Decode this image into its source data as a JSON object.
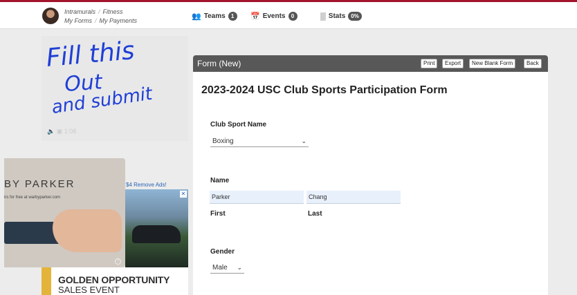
{
  "header": {
    "crumb_intramurals": "Intramurals",
    "crumb_sep": "/",
    "crumb_fitness": "Fitness",
    "my_forms": "My Forms",
    "my_payments": "My Payments",
    "nav": [
      {
        "label": "Teams",
        "count": "1",
        "icon": "people-icon"
      },
      {
        "label": "Events",
        "count": "0",
        "icon": "calendar-icon"
      },
      {
        "label": "Stats",
        "count": "0%",
        "icon": "bar-chart-icon"
      }
    ]
  },
  "video": {
    "handwriting": [
      "Fill this",
      "Out",
      "and submit"
    ],
    "controls": "1:08"
  },
  "ads": {
    "remove_ads": "$4 Remove Ads!",
    "ad1_brand": "BY PARKER",
    "ad1_tag": "irs for free at warbyparker.com",
    "ad3_line1": "GOLDEN OPPORTUNITY",
    "ad3_line2": "SALES EVENT"
  },
  "form": {
    "panel_title": "Form (New)",
    "buttons": {
      "print": "Print",
      "export": "Export",
      "new_blank": "New Blank Form",
      "back": "Back"
    },
    "title": "2023-2024 USC Club Sports Participation Form",
    "club_sport_label": "Club Sport Name",
    "club_sport_value": "Boxing",
    "name_label": "Name",
    "first_value": "Parker",
    "last_value": "Chang",
    "first_label": "First",
    "last_label": "Last",
    "gender_label": "Gender",
    "gender_value": "Male"
  },
  "colors": {
    "accent": "#a3142b",
    "panel_header": "#585858",
    "input_fill": "#e8f0fb",
    "link": "#2a62b5"
  }
}
